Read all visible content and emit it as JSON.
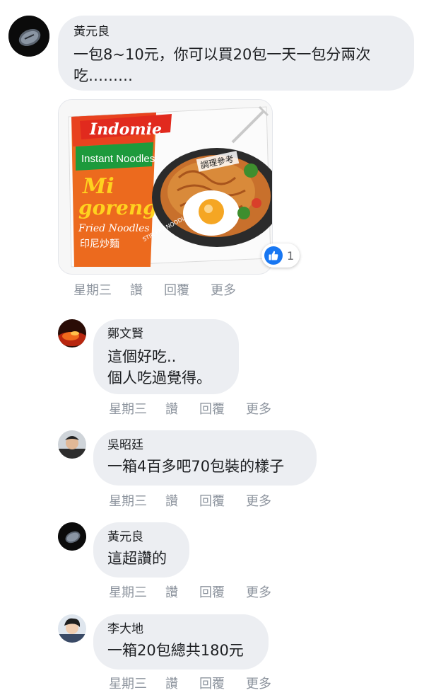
{
  "comments": [
    {
      "author": "黃元良",
      "text": "一包8~10元，你可以買20包一天一包分兩次\n吃………",
      "actions": [
        "星期三",
        "讚",
        "回覆",
        "更多"
      ],
      "reaction_count": "1",
      "photo": {
        "brand": "Indomie",
        "line1": "Instant Noodles",
        "line2": "Mi",
        "line3": "goreng",
        "line4": "Fried Noodles",
        "line5": "印尼炒麵",
        "serving_label": "調理參考",
        "stir_fry": "STIR FRY NOODLES",
        "mie": "炒麵"
      }
    },
    {
      "author": "鄭文賢",
      "text": "這個好吃..\n個人吃過覺得。",
      "actions": [
        "星期三",
        "讚",
        "回覆",
        "更多"
      ]
    },
    {
      "author": "吳昭廷",
      "text": "一箱4百多吧70包裝的樣子",
      "actions": [
        "星期三",
        "讚",
        "回覆",
        "更多"
      ]
    },
    {
      "author": "黃元良",
      "text": "這超讚的",
      "actions": [
        "星期三",
        "讚",
        "回覆",
        "更多"
      ]
    },
    {
      "author": "李大地",
      "text": "一箱20包總共180元",
      "actions": [
        "星期三",
        "讚",
        "回覆",
        "更多"
      ]
    }
  ]
}
